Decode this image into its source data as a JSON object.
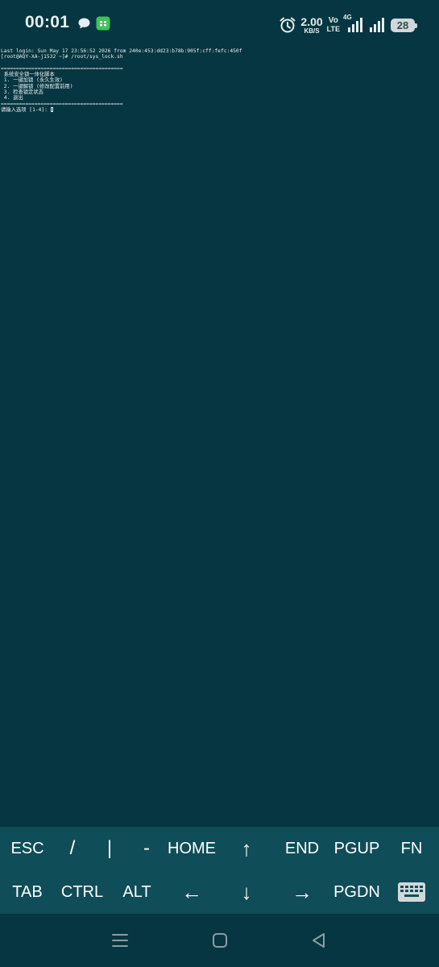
{
  "status_bar": {
    "time": "00:01",
    "net_speed_value": "2.00",
    "net_speed_unit": "KB/S",
    "volte_top": "Vo",
    "volte_bottom": "LTE",
    "network_type": "4G",
    "battery_level": "28"
  },
  "terminal": {
    "lines": [
      "Last login: Sun May 17 23:56:52 2026 from 240e:453:dd23:b78b:905f:cff:fefc:450f",
      "[root@AQY-XA-j1532 ~]# /root/sys_lock.sh",
      "",
      "========================================",
      " 系统安全锁一体化脚本",
      " 1. 一键加锁 (永久生效)",
      " 2. 一键解锁 (修改配置前用)",
      " 3. 检查锁定状态",
      " 4. 退出",
      "========================================"
    ],
    "prompt": "请输入选项 [1-4]: "
  },
  "extra_keys": {
    "row1": [
      "ESC",
      "/",
      "|",
      "-",
      "HOME",
      "↑",
      "END",
      "PGUP",
      "FN"
    ],
    "row2": [
      "TAB",
      "CTRL",
      "ALT",
      "←",
      "↓",
      "→",
      "PGDN"
    ]
  },
  "colors": {
    "terminal_bg": "#063641",
    "extra_keys_bg": "#0f4d58",
    "text": "#e9eff0"
  }
}
